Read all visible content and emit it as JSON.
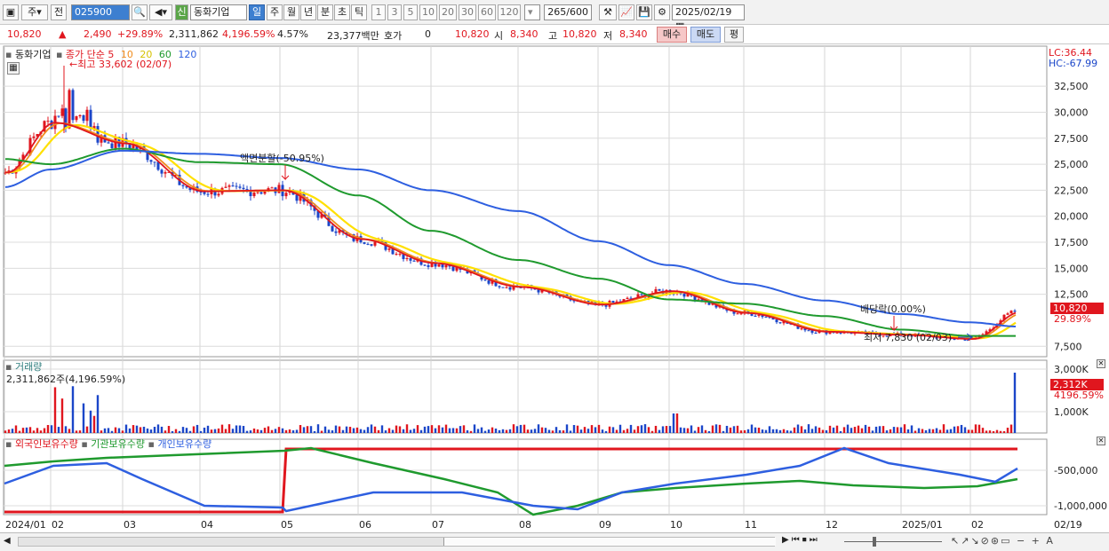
{
  "toolbar": {
    "period_type": "주",
    "prev_label": "전",
    "stock_code": "025900",
    "shin_label": "신",
    "stock_name": "동화기업",
    "periods": [
      "일",
      "주",
      "월",
      "년",
      "분",
      "초",
      "틱"
    ],
    "active_period": "일",
    "intervals": [
      "1",
      "3",
      "5",
      "10",
      "20",
      "30",
      "60",
      "120"
    ],
    "count": "265",
    "total": "600",
    "date": "2025/02/19"
  },
  "quote": {
    "price": "10,820",
    "change": "2,490",
    "change_pct": "+29.89%",
    "volume": "2,311,862",
    "volume_pct": "4,196.59%",
    "turnover": "4.57%",
    "amount": "23,377백만",
    "hoga_label": "호가",
    "hoga_value": "0",
    "bid": "10,820",
    "open_label": "시",
    "open": "8,340",
    "high_label": "고",
    "high": "10,820",
    "low_label": "저",
    "low": "8,340",
    "buy_label": "매수",
    "sell_label": "매도",
    "eval_label": "평"
  },
  "price_panel": {
    "title": "동화기업",
    "ma_label": "종가 단순",
    "ma_periods": [
      "5",
      "10",
      "20",
      "60",
      "120"
    ],
    "ma_colors": [
      "#e0161e",
      "#f08c1e",
      "#ffe000",
      "#1f9a2e",
      "#2e5fe0"
    ],
    "lc": "LC:36.44",
    "hc": "HC:-67.99",
    "y_ticks": [
      "32,500",
      "30,000",
      "27,500",
      "25,000",
      "22,500",
      "20,000",
      "17,500",
      "15,000",
      "12,500",
      "7,500"
    ],
    "annotations": {
      "high": "최고 33,602 (02/07)",
      "low": "최저 7,830 (02/03)",
      "split": "액면분할(-50.95%)",
      "dividend": "배당락(0.00%)"
    },
    "current_price": "10,820",
    "current_pct": "29.89%"
  },
  "volume_panel": {
    "title": "거래량",
    "value": "2,311,862주(4,196.59%)",
    "y_ticks": [
      "3,000K",
      "1,000K"
    ],
    "current": "2,312K",
    "current_pct": "4196.59%"
  },
  "holding_panel": {
    "legends": [
      "외국인보유수량",
      "기관보유수량",
      "개인보유수량"
    ],
    "colors": [
      "#e0161e",
      "#1f9a2e",
      "#2e5fe0"
    ],
    "y_ticks": [
      "-500,000",
      "-1,000,000"
    ]
  },
  "x_axis": {
    "labels": [
      "2024/01",
      "02",
      "03",
      "04",
      "05",
      "06",
      "07",
      "08",
      "09",
      "10",
      "11",
      "12",
      "2025/01",
      "02"
    ],
    "end_label": "02/19"
  },
  "chart_data": {
    "type": "line",
    "title": "",
    "x": [
      "2024/01",
      "02",
      "03",
      "04",
      "05",
      "06",
      "07",
      "08",
      "09",
      "10",
      "11",
      "12",
      "2025/01",
      "02",
      "02/19"
    ],
    "ylim": [
      6500,
      35500
    ],
    "series": [
      {
        "name": "5",
        "values": [
          24200,
          29000,
          27000,
          22400,
          22500,
          17800,
          15500,
          13200,
          11500,
          12800,
          10700,
          8900,
          8600,
          8200,
          10820
        ]
      },
      {
        "name": "60",
        "values": [
          25500,
          25000,
          26500,
          25200,
          25000,
          22000,
          18600,
          15800,
          14000,
          12000,
          11600,
          10400,
          9100,
          8500,
          8500
        ]
      },
      {
        "name": "120",
        "values": [
          22800,
          24500,
          26300,
          26000,
          25600,
          24500,
          22500,
          20500,
          17600,
          15300,
          13500,
          11900,
          10600,
          9800,
          9400
        ]
      }
    ]
  }
}
